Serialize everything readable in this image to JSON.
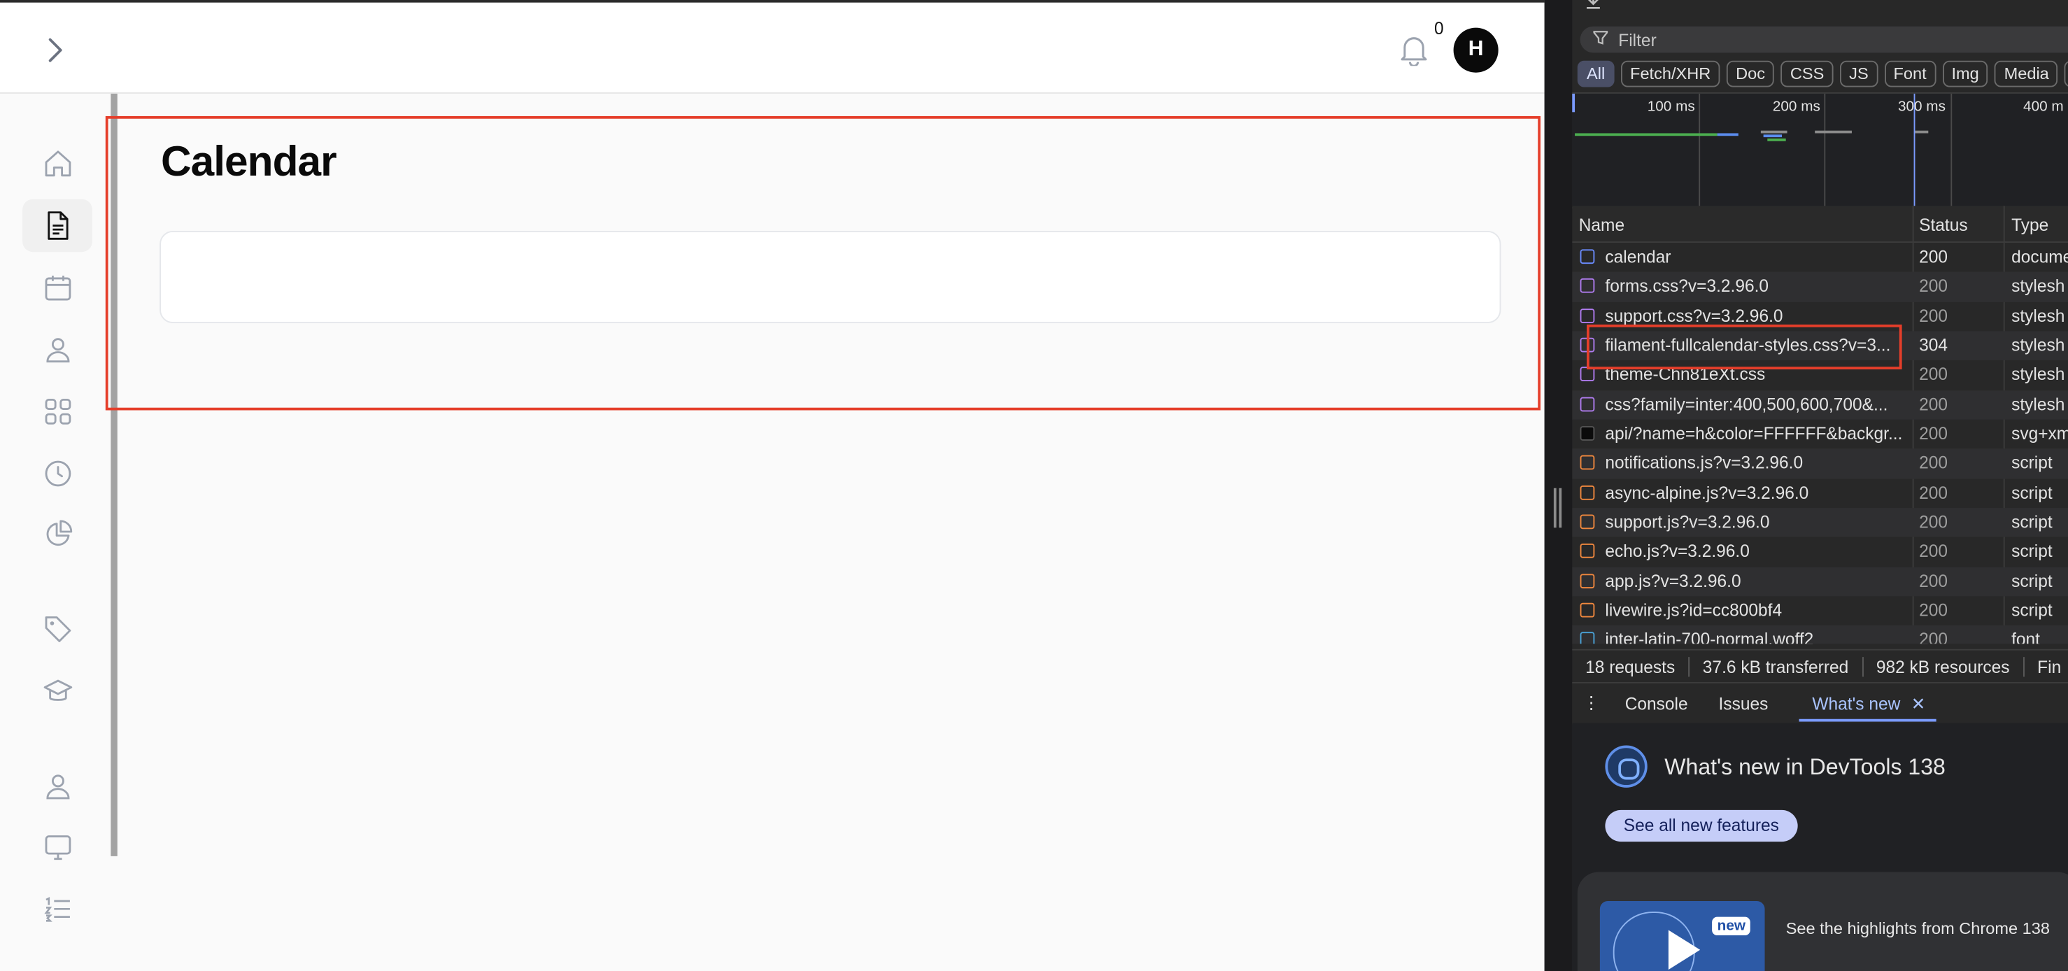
{
  "app": {
    "title": "Calendar",
    "notifications_count": "0",
    "avatar_initial": "H"
  },
  "devtools": {
    "filter_placeholder": "Filter",
    "chips": [
      "All",
      "Fetch/XHR",
      "Doc",
      "CSS",
      "JS",
      "Font",
      "Img",
      "Media",
      "M"
    ],
    "timeline_labels": [
      "100 ms",
      "200 ms",
      "300 ms",
      "400 m"
    ],
    "columns": {
      "name": "Name",
      "status": "Status",
      "type": "Type"
    },
    "requests": [
      {
        "name": "calendar",
        "status": "200",
        "type": "docume",
        "kind": "doc"
      },
      {
        "name": "forms.css?v=3.2.96.0",
        "status": "200",
        "type": "stylesh",
        "kind": "css"
      },
      {
        "name": "support.css?v=3.2.96.0",
        "status": "200",
        "type": "stylesh",
        "kind": "css"
      },
      {
        "name": "filament-fullcalendar-styles.css?v=3...",
        "status": "304",
        "type": "stylesh",
        "kind": "css"
      },
      {
        "name": "theme-Chn81eXt.css",
        "status": "200",
        "type": "stylesh",
        "kind": "css"
      },
      {
        "name": "css?family=inter:400,500,600,700&...",
        "status": "200",
        "type": "stylesh",
        "kind": "css"
      },
      {
        "name": "api/?name=h&color=FFFFFF&backgr...",
        "status": "200",
        "type": "svg+xm",
        "kind": "img"
      },
      {
        "name": "notifications.js?v=3.2.96.0",
        "status": "200",
        "type": "script",
        "kind": "js"
      },
      {
        "name": "async-alpine.js?v=3.2.96.0",
        "status": "200",
        "type": "script",
        "kind": "js"
      },
      {
        "name": "support.js?v=3.2.96.0",
        "status": "200",
        "type": "script",
        "kind": "js"
      },
      {
        "name": "echo.js?v=3.2.96.0",
        "status": "200",
        "type": "script",
        "kind": "js"
      },
      {
        "name": "app.js?v=3.2.96.0",
        "status": "200",
        "type": "script",
        "kind": "js"
      },
      {
        "name": "livewire.js?id=cc800bf4",
        "status": "200",
        "type": "script",
        "kind": "js"
      },
      {
        "name": "inter-latin-700-normal.woff2",
        "status": "200",
        "type": "font",
        "kind": "font"
      }
    ],
    "summary": [
      "18 requests",
      "37.6 kB transferred",
      "982 kB resources",
      "Fin"
    ],
    "drawer_tabs": [
      "Console",
      "Issues",
      "What's new"
    ],
    "whats_new": {
      "title": "What's new in DevTools 138",
      "button": "See all new features",
      "badge": "new",
      "card_text": "See the highlights from Chrome 138"
    }
  }
}
